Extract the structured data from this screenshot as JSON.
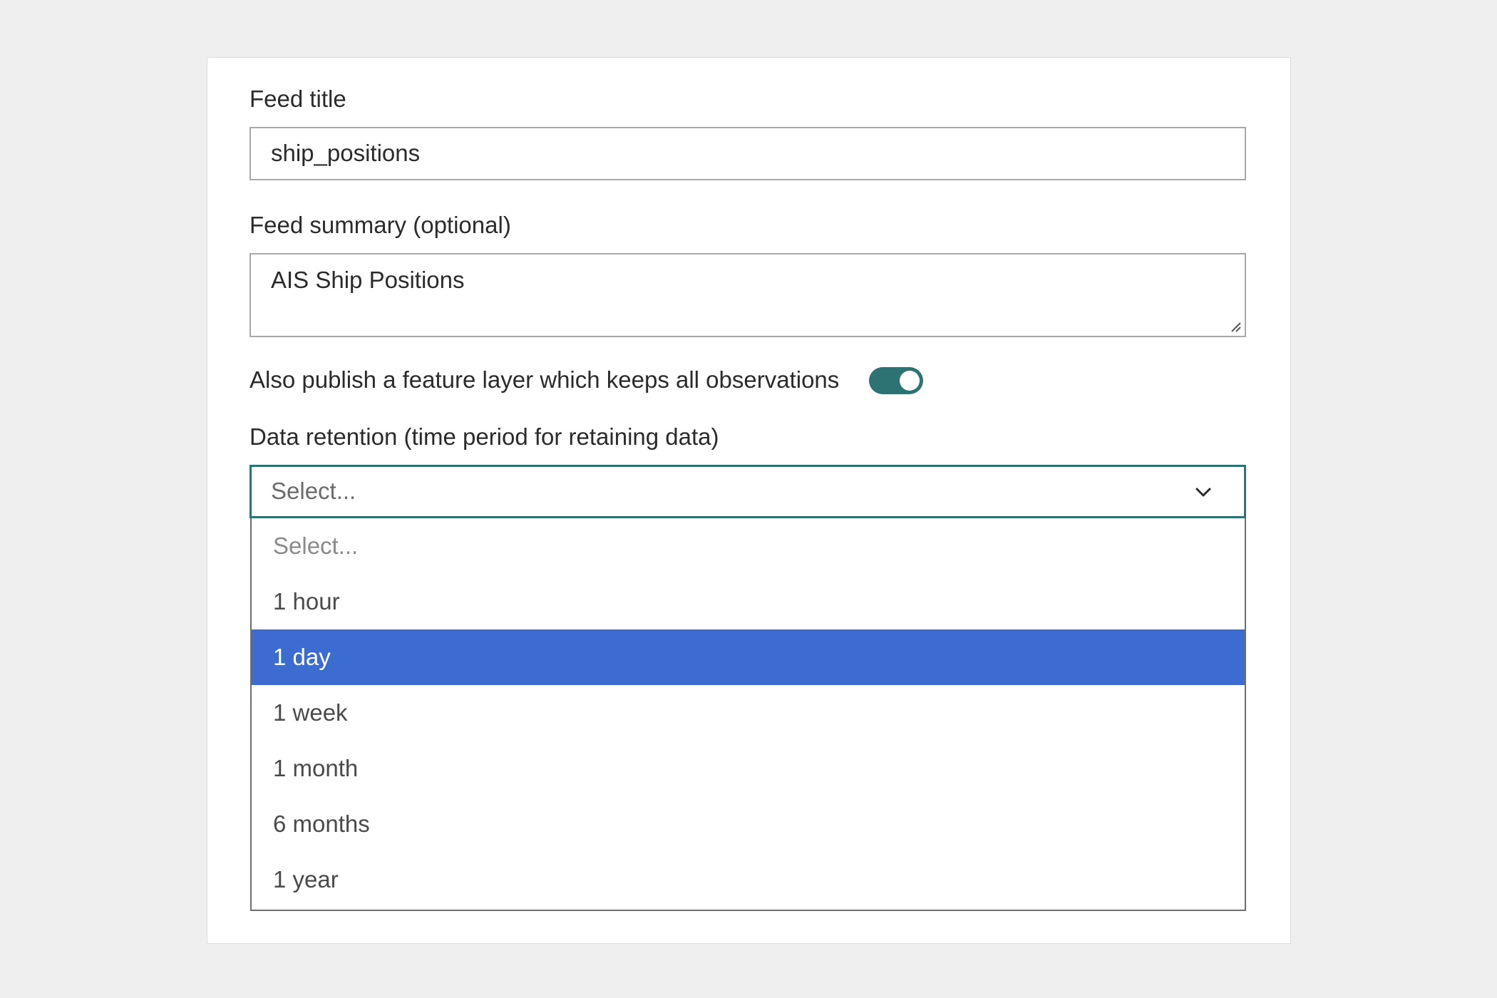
{
  "form": {
    "feed_title_label": "Feed title",
    "feed_title_value": "ship_positions",
    "feed_summary_label": "Feed summary (optional)",
    "feed_summary_value": "AIS Ship Positions",
    "publish_toggle_label": "Also publish a feature layer which keeps all observations",
    "publish_toggle_on": true,
    "retention_label": "Data retention (time period for retaining data)",
    "retention_selected": "Select...",
    "retention_options": [
      {
        "label": "Select...",
        "placeholder": true
      },
      {
        "label": "1 hour"
      },
      {
        "label": "1 day",
        "highlighted": true
      },
      {
        "label": "1 week"
      },
      {
        "label": "1 month"
      },
      {
        "label": "6 months"
      },
      {
        "label": "1 year"
      }
    ]
  },
  "icons": {
    "select_arrow": "chevron-down-icon",
    "textarea_resize": "resize-handle-icon"
  },
  "colors": {
    "accent": "#2e7373",
    "highlight": "#3c6ccf",
    "background": "#efefef",
    "panel": "#ffffff"
  }
}
